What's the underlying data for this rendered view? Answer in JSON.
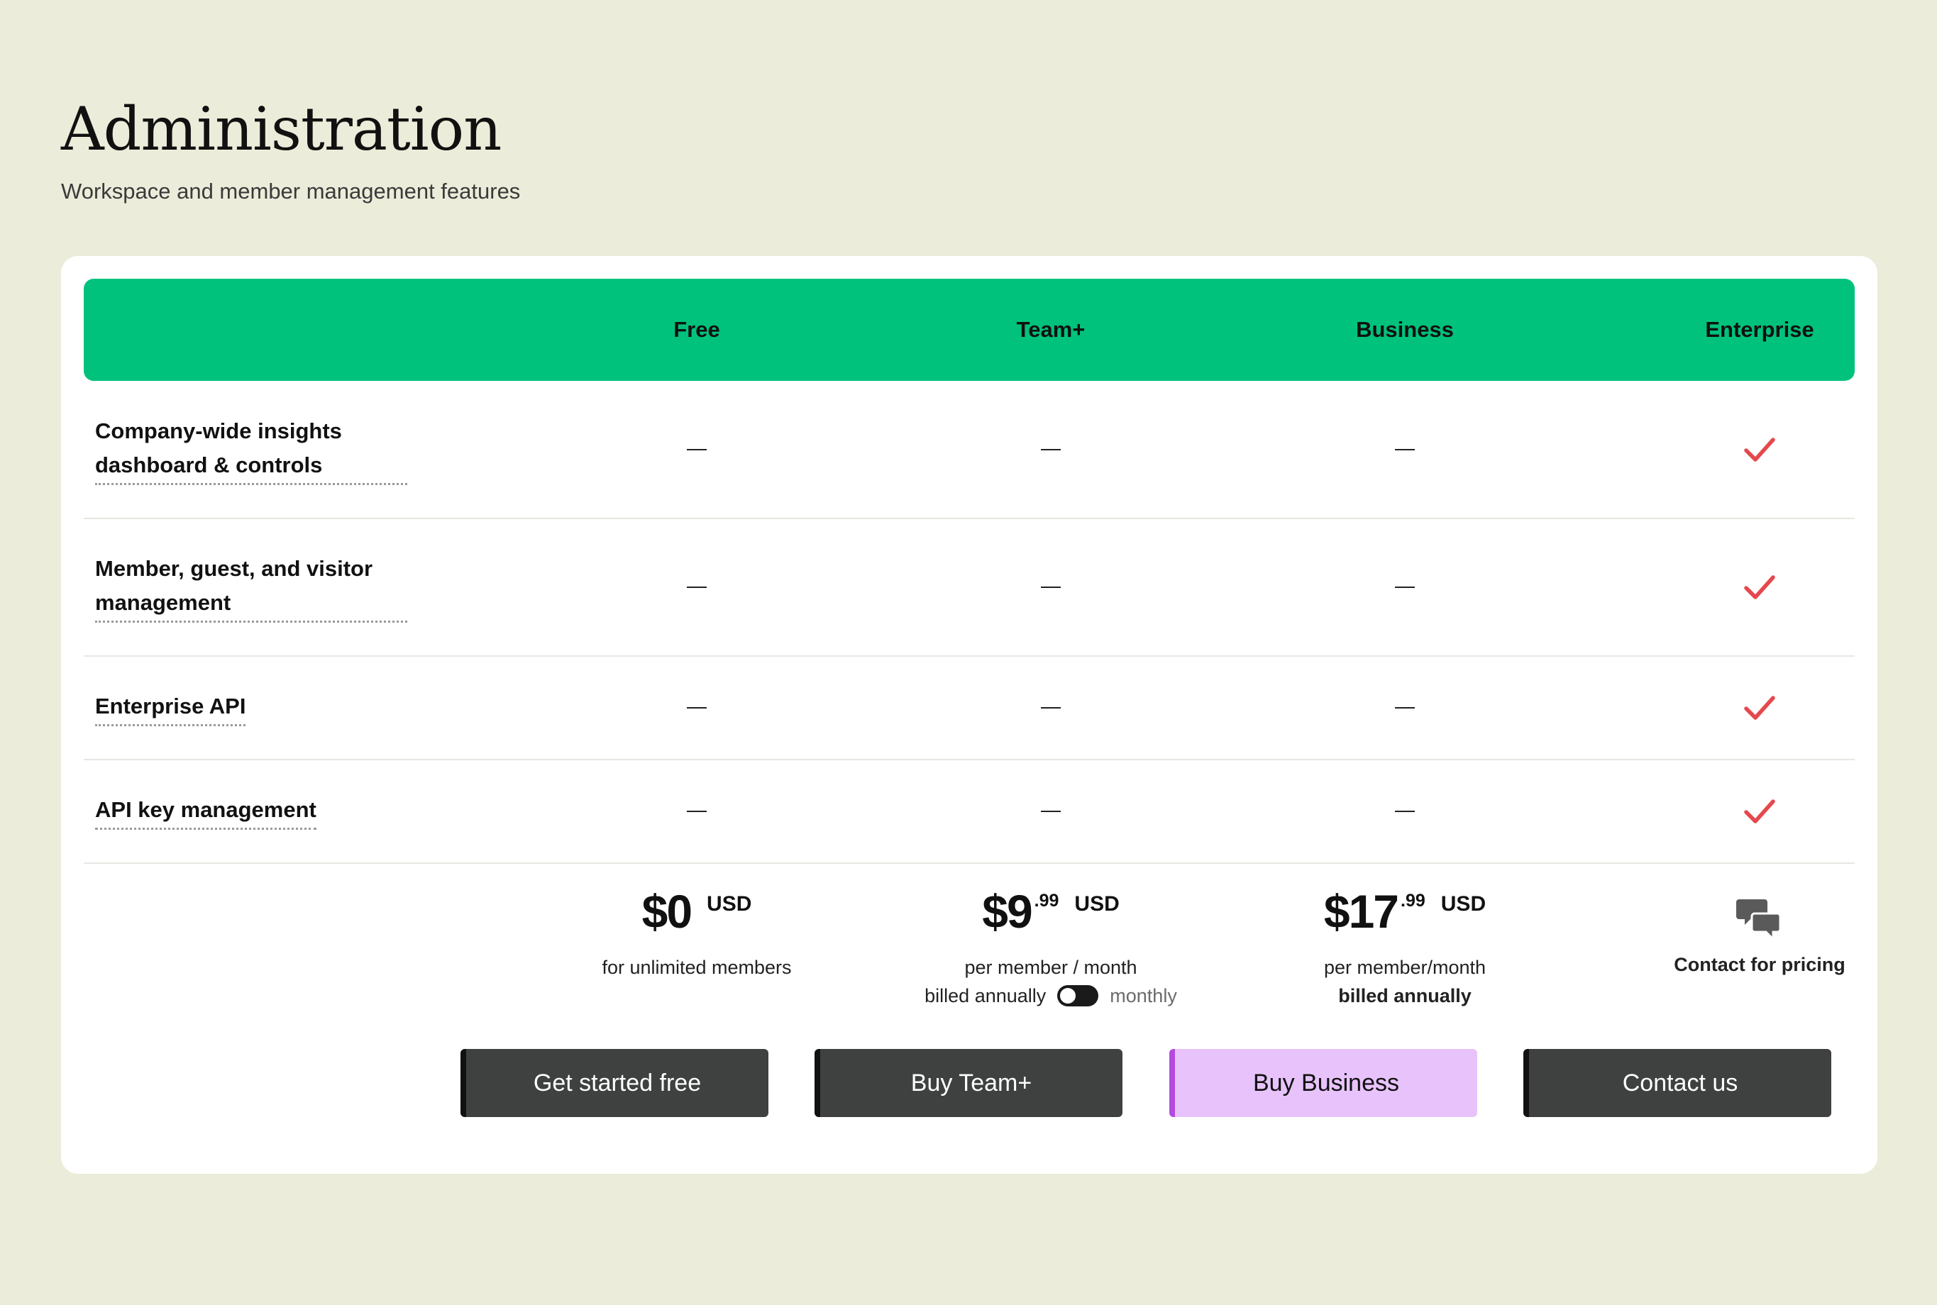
{
  "page": {
    "title": "Administration",
    "subtitle": "Workspace and member management features"
  },
  "plans": [
    {
      "name": "Free"
    },
    {
      "name": "Team+"
    },
    {
      "name": "Business"
    },
    {
      "name": "Enterprise"
    }
  ],
  "features": [
    {
      "label": "Company-wide insights dashboard & controls",
      "values": [
        "—",
        "—",
        "—",
        "check"
      ]
    },
    {
      "label": "Member, guest, and visitor management",
      "values": [
        "—",
        "—",
        "—",
        "check"
      ]
    },
    {
      "label": "Enterprise API",
      "values": [
        "—",
        "—",
        "—",
        "check"
      ]
    },
    {
      "label": "API key management",
      "values": [
        "—",
        "—",
        "—",
        "check"
      ]
    }
  ],
  "pricing": {
    "free": {
      "amount": "$0",
      "currency": "USD",
      "note": "for unlimited members"
    },
    "team": {
      "amount": "$9",
      "cents": ".99",
      "currency": "USD",
      "note": "per member / month",
      "billing_left": "billed annually",
      "billing_right": "monthly"
    },
    "business": {
      "amount": "$17",
      "cents": ".99",
      "currency": "USD",
      "note": "per member/month",
      "billing": "billed annually"
    },
    "enterprise": {
      "note": "Contact for pricing",
      "icon": "chat-bubbles-icon"
    }
  },
  "buttons": {
    "free": "Get started free",
    "team": "Buy Team+",
    "business": "Buy Business",
    "enterprise": "Contact us"
  },
  "colors": {
    "background": "#ECECDA",
    "header": "#00C27C",
    "check": "#E5484D",
    "button": "#3F4140",
    "business_button": "#E8C3FB",
    "business_accent": "#B44AE0"
  }
}
